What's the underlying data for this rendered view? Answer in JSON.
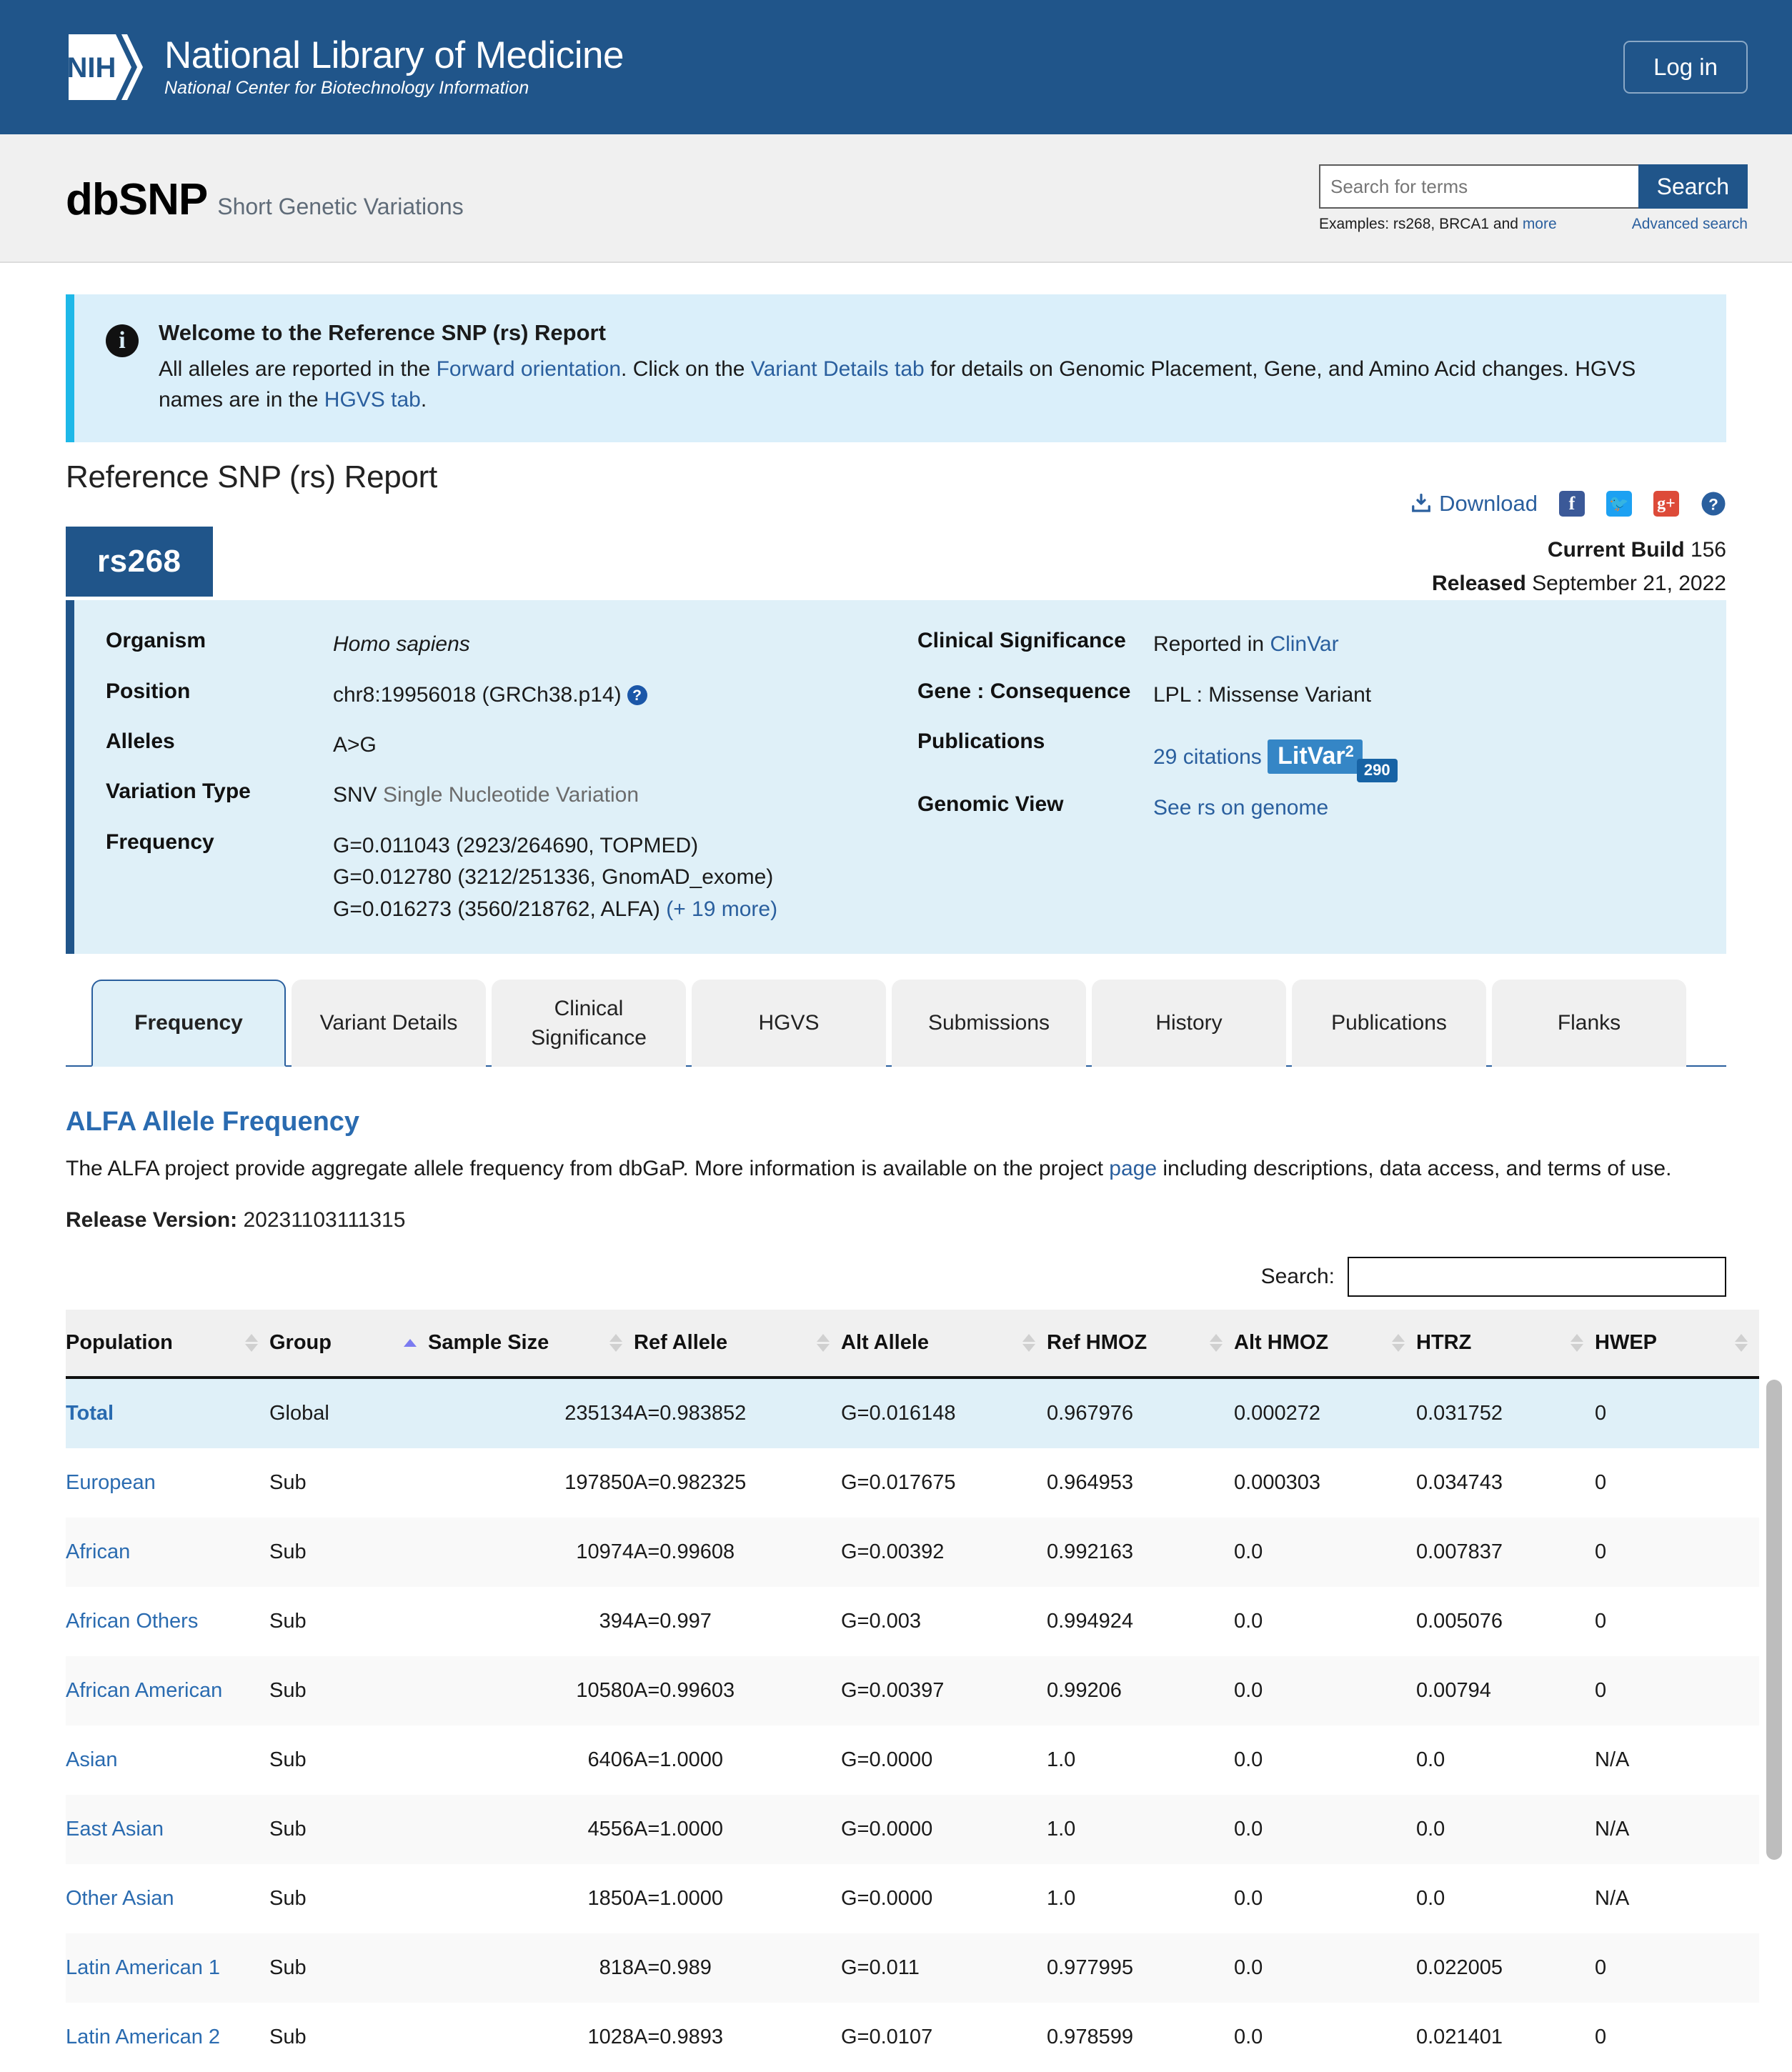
{
  "nih": {
    "logo_text": "NIH",
    "title": "National Library of Medicine",
    "subtitle": "National Center for Biotechnology Information",
    "login_label": "Log in"
  },
  "site": {
    "logo": "dbSNP",
    "tagline": "Short Genetic Variations"
  },
  "search": {
    "placeholder": "Search for terms",
    "value": "",
    "button_label": "Search",
    "examples_prefix": "Examples: rs268, BRCA1 and ",
    "examples_link": "more",
    "advanced_label": "Advanced search"
  },
  "welcome": {
    "title": "Welcome to the Reference SNP (rs) Report",
    "text_1": "All alleles are reported in the ",
    "link_1": "Forward orientation",
    "text_2": ". Click on the ",
    "link_2": "Variant Details tab",
    "text_3": " for details on Genomic Placement, Gene, and Amino Acid changes. HGVS names are in the ",
    "link_3": "HGVS tab",
    "text_4": "."
  },
  "report": {
    "title": "Reference SNP (rs) Report",
    "download_label": "Download",
    "social": [
      "facebook-icon",
      "twitter-icon",
      "google-plus-icon",
      "help-icon"
    ]
  },
  "summary": {
    "rs_id": "rs268",
    "current_build_label": "Current Build",
    "current_build_value": "156",
    "released_label": "Released",
    "released_value": "September 21, 2022",
    "left": [
      {
        "label": "Organism",
        "value": "Homo sapiens",
        "style": "italic"
      },
      {
        "label": "Position",
        "value": "chr8:19956018 (GRCh38.p14)",
        "help": "?"
      },
      {
        "label": "Alleles",
        "value": "A>G"
      },
      {
        "label": "Variation Type",
        "value": "SNV",
        "value_muted": "Single Nucleotide Variation"
      },
      {
        "label": "Frequency",
        "lines": [
          "G=0.011043 (2923/264690, TOPMED)",
          "G=0.012780 (3212/251336, GnomAD_exome)",
          "G=0.016273 (3560/218762, ALFA) "
        ],
        "more_link": "(+ 19 more)"
      }
    ],
    "right": {
      "clinical_label": "Clinical Significance",
      "clinical_prefix": "Reported in ",
      "clinical_link": "ClinVar",
      "gene_label": "Gene : Consequence",
      "gene_value": "LPL : Missense Variant",
      "publications_label": "Publications",
      "publications_link": "29 citations",
      "litvar_name": "LitVar",
      "litvar_sup": "2",
      "litvar_count": "290",
      "genomic_label": "Genomic View",
      "genomic_link": "See rs on genome"
    }
  },
  "tabs": [
    {
      "label": "Frequency",
      "active": true
    },
    {
      "label": "Variant Details",
      "active": false
    },
    {
      "label": "Clinical Significance",
      "active": false
    },
    {
      "label": "HGVS",
      "active": false
    },
    {
      "label": "Submissions",
      "active": false
    },
    {
      "label": "History",
      "active": false
    },
    {
      "label": "Publications",
      "active": false
    },
    {
      "label": "Flanks",
      "active": false
    }
  ],
  "alfa": {
    "heading": "ALFA Allele Frequency",
    "desc_1": "The ALFA project provide aggregate allele frequency from dbGaP. More information is available on the project ",
    "desc_link": "page",
    "desc_2": " including descriptions, data access, and terms of use.",
    "release_label": "Release Version:",
    "release_value": "20231103111315",
    "table_search_label": "Search:",
    "table_search_value": "",
    "columns": [
      {
        "label": "Population",
        "sort": "none"
      },
      {
        "label": "Group",
        "sort": "asc"
      },
      {
        "label": "Sample Size",
        "sort": "none"
      },
      {
        "label": "Ref Allele",
        "sort": "none"
      },
      {
        "label": "Alt Allele",
        "sort": "none"
      },
      {
        "label": "Ref HMOZ",
        "sort": "none"
      },
      {
        "label": "Alt HMOZ",
        "sort": "none"
      },
      {
        "label": "HTRZ",
        "sort": "none"
      },
      {
        "label": "HWEP",
        "sort": "none"
      }
    ],
    "rows": [
      {
        "population": "Total",
        "group": "Global",
        "sample_size": "235134",
        "ref_allele": "A=0.983852",
        "alt_allele": "G=0.016148",
        "ref_hmoz": "0.967976",
        "alt_hmoz": "0.000272",
        "htrz": "0.031752",
        "hwep": "0",
        "total": true
      },
      {
        "population": "European",
        "group": "Sub",
        "sample_size": "197850",
        "ref_allele": "A=0.982325",
        "alt_allele": "G=0.017675",
        "ref_hmoz": "0.964953",
        "alt_hmoz": "0.000303",
        "htrz": "0.034743",
        "hwep": "0"
      },
      {
        "population": "African",
        "group": "Sub",
        "sample_size": "10974",
        "ref_allele": "A=0.99608",
        "alt_allele": "G=0.00392",
        "ref_hmoz": "0.992163",
        "alt_hmoz": "0.0",
        "htrz": "0.007837",
        "hwep": "0"
      },
      {
        "population": "African Others",
        "group": "Sub",
        "sample_size": "394",
        "ref_allele": "A=0.997",
        "alt_allele": "G=0.003",
        "ref_hmoz": "0.994924",
        "alt_hmoz": "0.0",
        "htrz": "0.005076",
        "hwep": "0"
      },
      {
        "population": "African American",
        "group": "Sub",
        "sample_size": "10580",
        "ref_allele": "A=0.99603",
        "alt_allele": "G=0.00397",
        "ref_hmoz": "0.99206",
        "alt_hmoz": "0.0",
        "htrz": "0.00794",
        "hwep": "0"
      },
      {
        "population": "Asian",
        "group": "Sub",
        "sample_size": "6406",
        "ref_allele": "A=1.0000",
        "alt_allele": "G=0.0000",
        "ref_hmoz": "1.0",
        "alt_hmoz": "0.0",
        "htrz": "0.0",
        "hwep": "N/A"
      },
      {
        "population": "East Asian",
        "group": "Sub",
        "sample_size": "4556",
        "ref_allele": "A=1.0000",
        "alt_allele": "G=0.0000",
        "ref_hmoz": "1.0",
        "alt_hmoz": "0.0",
        "htrz": "0.0",
        "hwep": "N/A"
      },
      {
        "population": "Other Asian",
        "group": "Sub",
        "sample_size": "1850",
        "ref_allele": "A=1.0000",
        "alt_allele": "G=0.0000",
        "ref_hmoz": "1.0",
        "alt_hmoz": "0.0",
        "htrz": "0.0",
        "hwep": "N/A"
      },
      {
        "population": "Latin American 1",
        "group": "Sub",
        "sample_size": "818",
        "ref_allele": "A=0.989",
        "alt_allele": "G=0.011",
        "ref_hmoz": "0.977995",
        "alt_hmoz": "0.0",
        "htrz": "0.022005",
        "hwep": "0"
      },
      {
        "population": "Latin American 2",
        "group": "Sub",
        "sample_size": "1028",
        "ref_allele": "A=0.9893",
        "alt_allele": "G=0.0107",
        "ref_hmoz": "0.978599",
        "alt_hmoz": "0.0",
        "htrz": "0.021401",
        "hwep": "0"
      }
    ]
  },
  "colors": {
    "nih_blue": "#20558a",
    "accent_blue": "#2a6bb0",
    "banner_bg": "#daeffa",
    "banner_border": "#1eb8e8",
    "panel_bg": "#dff0f8"
  }
}
